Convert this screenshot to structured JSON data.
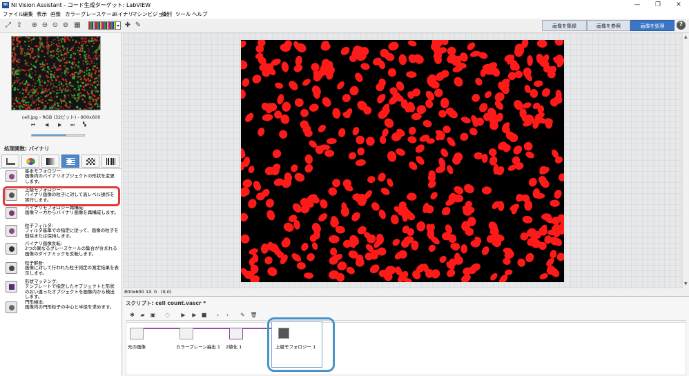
{
  "window": {
    "title": "NI Vision Assistant - コード生成ターゲット: LabVIEW",
    "icon_text": "NI",
    "controls": [
      "—",
      "❐",
      "✕"
    ]
  },
  "menu": {
    "items": [
      "ファイル",
      "編集",
      "表示",
      "画像",
      "カラー",
      "グレースケール",
      "バイナリ",
      "マシンビジョン",
      "識別",
      "ツール",
      "ヘルプ"
    ]
  },
  "toolbar": {
    "icons": [
      "acquire-icon",
      "export-icon",
      "zoom-in-icon",
      "zoom-out-icon",
      "zoom-fit-icon",
      "zoom-1x-icon",
      "pan-icon",
      "palette-selector",
      "roi-point-icon",
      "pen-icon"
    ]
  },
  "modes": {
    "collect": "画像を集録",
    "browse": "画像を参照",
    "process": "画像を処理",
    "help": "?"
  },
  "thumbnail": {
    "caption": "cell.jpg - RGB (32ビット) - 800x600",
    "nav": [
      "⏮",
      "◀",
      "▶",
      "⏭"
    ]
  },
  "processing": {
    "header": "処理関数: バイナリ",
    "selected_tab": "binary",
    "functions": [
      {
        "title": "基本モフォロジー:",
        "desc": "画像内のバイナリオブジェクトの形状を変更します。"
      },
      {
        "title": "上級モフォロジー:",
        "desc": "バイナリ画像の粒子に対して高レベル操作を実行します。"
      },
      {
        "title": "バイナリモフォロジー再構成:",
        "desc": "画像マーカからバイナリ画像を再構成します。"
      },
      {
        "title": "粒子フィルタ:",
        "desc": "フィルタ基準での指定に従って、画像の粒子を削除または保持します。"
      },
      {
        "title": "バイナリ画像反転:",
        "desc": "2つの異なるグレースケールの集合が含まれる画像のダイナミックを反転します。"
      },
      {
        "title": "粒子解析:",
        "desc": "画像に対して行われた粒子測定の測定結果を表示します。"
      },
      {
        "title": "形状マッチング:",
        "desc": "テンプレートで指定したオブジェクトと形状のおい違ったオブジェクトを画像内から検出します。"
      },
      {
        "title": "円形検出:",
        "desc": "画像内の円形粒子の中心と半径を求めます。"
      }
    ]
  },
  "status": {
    "size": "800x600",
    "zoom": "1X",
    "value": "0",
    "coords": "(0,0)"
  },
  "script": {
    "title": "スクリプト: cell count.vascr *",
    "steps": [
      {
        "label": "元の画像"
      },
      {
        "label": "カラープレーン抽出 1"
      },
      {
        "label": "2値化 1"
      },
      {
        "label": "上級モフォロジー 1"
      }
    ]
  },
  "colors": {
    "accent": "#3a76c4",
    "highlight_red": "#e03a3a",
    "highlight_blue": "#4a92c8",
    "particle": "#ff1a1a"
  }
}
